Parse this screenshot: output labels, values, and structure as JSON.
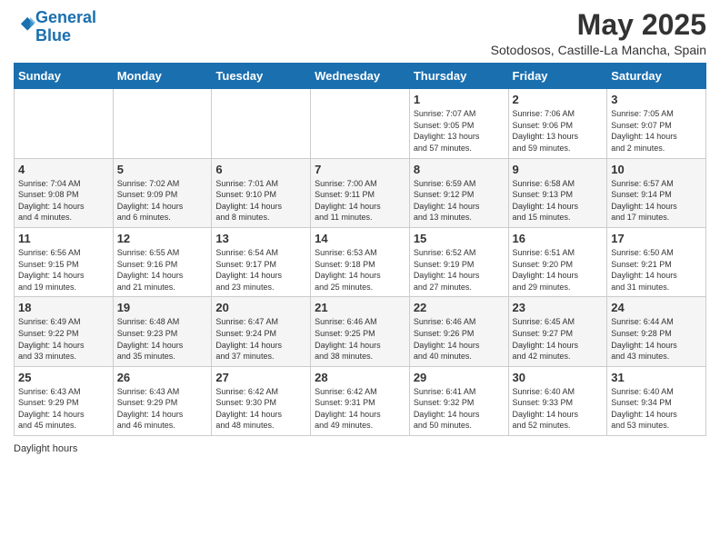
{
  "header": {
    "logo_line1": "General",
    "logo_line2": "Blue",
    "month_title": "May 2025",
    "location": "Sotodosos, Castille-La Mancha, Spain"
  },
  "days_of_week": [
    "Sunday",
    "Monday",
    "Tuesday",
    "Wednesday",
    "Thursday",
    "Friday",
    "Saturday"
  ],
  "weeks": [
    [
      {
        "day": "",
        "info": ""
      },
      {
        "day": "",
        "info": ""
      },
      {
        "day": "",
        "info": ""
      },
      {
        "day": "",
        "info": ""
      },
      {
        "day": "1",
        "info": "Sunrise: 7:07 AM\nSunset: 9:05 PM\nDaylight: 13 hours\nand 57 minutes."
      },
      {
        "day": "2",
        "info": "Sunrise: 7:06 AM\nSunset: 9:06 PM\nDaylight: 13 hours\nand 59 minutes."
      },
      {
        "day": "3",
        "info": "Sunrise: 7:05 AM\nSunset: 9:07 PM\nDaylight: 14 hours\nand 2 minutes."
      }
    ],
    [
      {
        "day": "4",
        "info": "Sunrise: 7:04 AM\nSunset: 9:08 PM\nDaylight: 14 hours\nand 4 minutes."
      },
      {
        "day": "5",
        "info": "Sunrise: 7:02 AM\nSunset: 9:09 PM\nDaylight: 14 hours\nand 6 minutes."
      },
      {
        "day": "6",
        "info": "Sunrise: 7:01 AM\nSunset: 9:10 PM\nDaylight: 14 hours\nand 8 minutes."
      },
      {
        "day": "7",
        "info": "Sunrise: 7:00 AM\nSunset: 9:11 PM\nDaylight: 14 hours\nand 11 minutes."
      },
      {
        "day": "8",
        "info": "Sunrise: 6:59 AM\nSunset: 9:12 PM\nDaylight: 14 hours\nand 13 minutes."
      },
      {
        "day": "9",
        "info": "Sunrise: 6:58 AM\nSunset: 9:13 PM\nDaylight: 14 hours\nand 15 minutes."
      },
      {
        "day": "10",
        "info": "Sunrise: 6:57 AM\nSunset: 9:14 PM\nDaylight: 14 hours\nand 17 minutes."
      }
    ],
    [
      {
        "day": "11",
        "info": "Sunrise: 6:56 AM\nSunset: 9:15 PM\nDaylight: 14 hours\nand 19 minutes."
      },
      {
        "day": "12",
        "info": "Sunrise: 6:55 AM\nSunset: 9:16 PM\nDaylight: 14 hours\nand 21 minutes."
      },
      {
        "day": "13",
        "info": "Sunrise: 6:54 AM\nSunset: 9:17 PM\nDaylight: 14 hours\nand 23 minutes."
      },
      {
        "day": "14",
        "info": "Sunrise: 6:53 AM\nSunset: 9:18 PM\nDaylight: 14 hours\nand 25 minutes."
      },
      {
        "day": "15",
        "info": "Sunrise: 6:52 AM\nSunset: 9:19 PM\nDaylight: 14 hours\nand 27 minutes."
      },
      {
        "day": "16",
        "info": "Sunrise: 6:51 AM\nSunset: 9:20 PM\nDaylight: 14 hours\nand 29 minutes."
      },
      {
        "day": "17",
        "info": "Sunrise: 6:50 AM\nSunset: 9:21 PM\nDaylight: 14 hours\nand 31 minutes."
      }
    ],
    [
      {
        "day": "18",
        "info": "Sunrise: 6:49 AM\nSunset: 9:22 PM\nDaylight: 14 hours\nand 33 minutes."
      },
      {
        "day": "19",
        "info": "Sunrise: 6:48 AM\nSunset: 9:23 PM\nDaylight: 14 hours\nand 35 minutes."
      },
      {
        "day": "20",
        "info": "Sunrise: 6:47 AM\nSunset: 9:24 PM\nDaylight: 14 hours\nand 37 minutes."
      },
      {
        "day": "21",
        "info": "Sunrise: 6:46 AM\nSunset: 9:25 PM\nDaylight: 14 hours\nand 38 minutes."
      },
      {
        "day": "22",
        "info": "Sunrise: 6:46 AM\nSunset: 9:26 PM\nDaylight: 14 hours\nand 40 minutes."
      },
      {
        "day": "23",
        "info": "Sunrise: 6:45 AM\nSunset: 9:27 PM\nDaylight: 14 hours\nand 42 minutes."
      },
      {
        "day": "24",
        "info": "Sunrise: 6:44 AM\nSunset: 9:28 PM\nDaylight: 14 hours\nand 43 minutes."
      }
    ],
    [
      {
        "day": "25",
        "info": "Sunrise: 6:43 AM\nSunset: 9:29 PM\nDaylight: 14 hours\nand 45 minutes."
      },
      {
        "day": "26",
        "info": "Sunrise: 6:43 AM\nSunset: 9:29 PM\nDaylight: 14 hours\nand 46 minutes."
      },
      {
        "day": "27",
        "info": "Sunrise: 6:42 AM\nSunset: 9:30 PM\nDaylight: 14 hours\nand 48 minutes."
      },
      {
        "day": "28",
        "info": "Sunrise: 6:42 AM\nSunset: 9:31 PM\nDaylight: 14 hours\nand 49 minutes."
      },
      {
        "day": "29",
        "info": "Sunrise: 6:41 AM\nSunset: 9:32 PM\nDaylight: 14 hours\nand 50 minutes."
      },
      {
        "day": "30",
        "info": "Sunrise: 6:40 AM\nSunset: 9:33 PM\nDaylight: 14 hours\nand 52 minutes."
      },
      {
        "day": "31",
        "info": "Sunrise: 6:40 AM\nSunset: 9:34 PM\nDaylight: 14 hours\nand 53 minutes."
      }
    ]
  ],
  "footer_note": "Daylight hours"
}
